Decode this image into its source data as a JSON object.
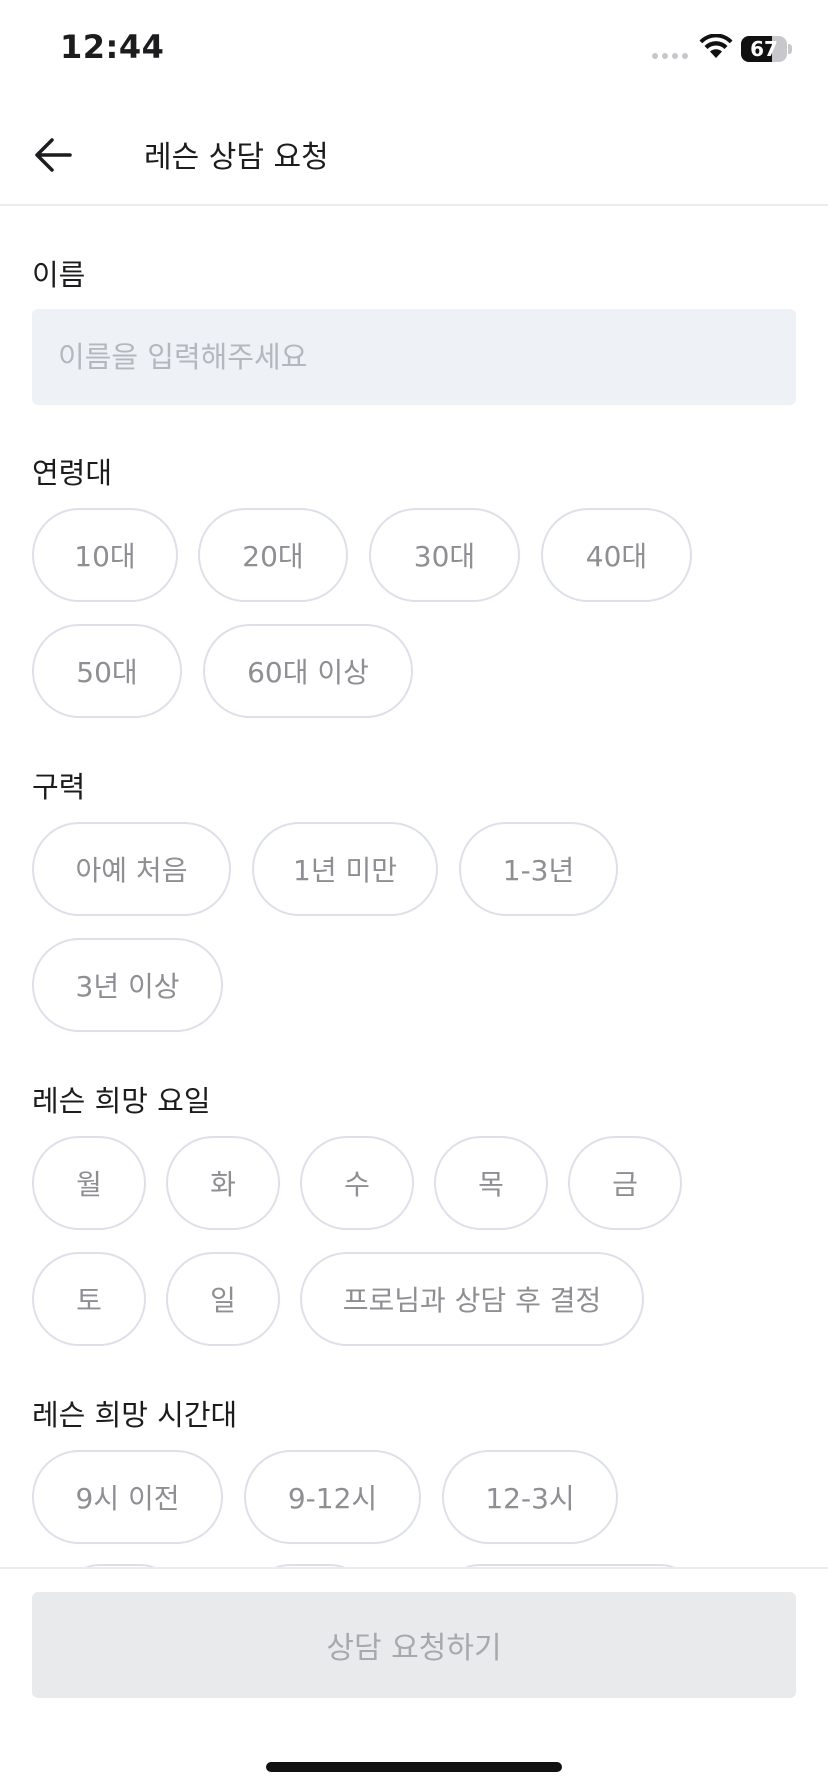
{
  "status_bar": {
    "time": "12:44",
    "battery": "67",
    "battery_level": 0.67
  },
  "header": {
    "title": "레슨 상담 요청"
  },
  "form": {
    "name": {
      "label": "이름",
      "placeholder": "이름을 입력해주세요",
      "value": ""
    },
    "age": {
      "label": "연령대",
      "options": [
        "10대",
        "20대",
        "30대",
        "40대",
        "50대",
        "60대 이상"
      ]
    },
    "experience": {
      "label": "구력",
      "options": [
        "아예 처음",
        "1년 미만",
        "1-3년",
        "3년 이상"
      ]
    },
    "days": {
      "label": "레슨 희망 요일",
      "options": [
        "월",
        "화",
        "수",
        "목",
        "금",
        "토",
        "일",
        "프로님과 상담 후 결정"
      ]
    },
    "time": {
      "label": "레슨 희망 시간대",
      "options": [
        "9시 이전",
        "9-12시",
        "12-3시"
      ]
    }
  },
  "submit_label": "상담 요청하기",
  "colors": {
    "chip_border": "#dde0ea",
    "chip_text": "#8e8e93",
    "input_bg": "#eef1f5",
    "button_bg": "#e9eaec",
    "button_text": "#a7a9ad"
  }
}
